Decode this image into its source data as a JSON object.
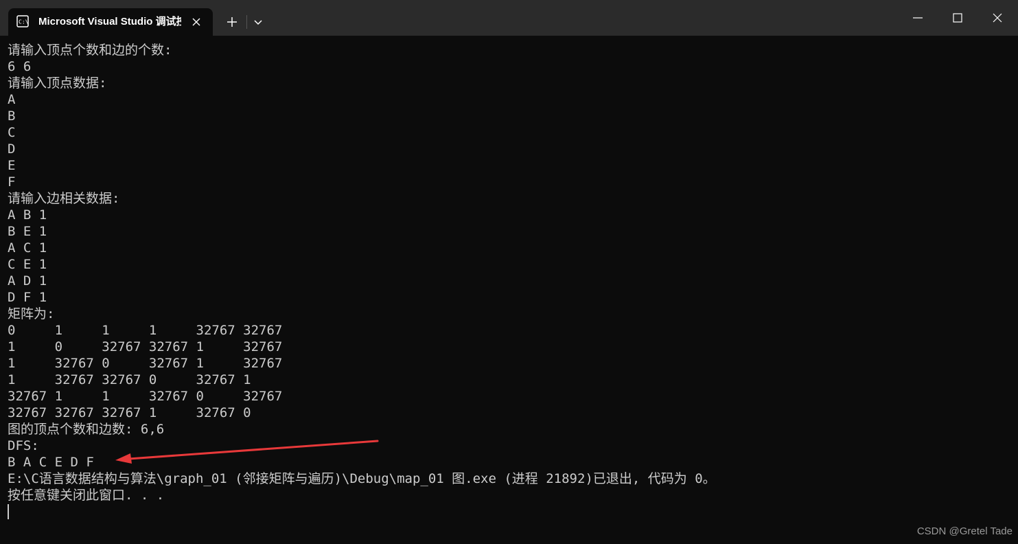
{
  "window": {
    "tab_title": "Microsoft Visual Studio 调试控制台",
    "new_tab_icon": "plus-icon",
    "dropdown_icon": "chevron-down-icon",
    "controls": [
      "minimize-icon",
      "maximize-icon",
      "close-icon"
    ]
  },
  "console": {
    "lines": [
      "请输入顶点个数和边的个数:",
      "6 6",
      "请输入顶点数据:",
      "A",
      "B",
      "C",
      "D",
      "E",
      "F",
      "请输入边相关数据:",
      "A B 1",
      "B E 1",
      "A C 1",
      "C E 1",
      "A D 1",
      "D F 1",
      "矩阵为:",
      "0     1     1     1     32767 32767",
      "1     0     32767 32767 1     32767",
      "1     32767 0     32767 1     32767",
      "1     32767 32767 0     32767 1",
      "32767 1     1     32767 0     32767",
      "32767 32767 32767 1     32767 0",
      "图的顶点个数和边数: 6,6",
      "DFS:",
      "B A C E D F",
      "E:\\C语言数据结构与算法\\graph_01 (邻接矩阵与遍历)\\Debug\\map_01 图.exe (进程 21892)已退出, 代码为 0。",
      "按任意键关闭此窗口. . ."
    ]
  },
  "annotation": {
    "arrow_color": "#e8393a",
    "arrow_icon": "red-arrow-icon"
  },
  "watermark": "CSDN @Gretel Tade",
  "colors": {
    "background": "#0c0c0c",
    "titlebar": "#2b2b2b",
    "text": "#cccccc"
  }
}
